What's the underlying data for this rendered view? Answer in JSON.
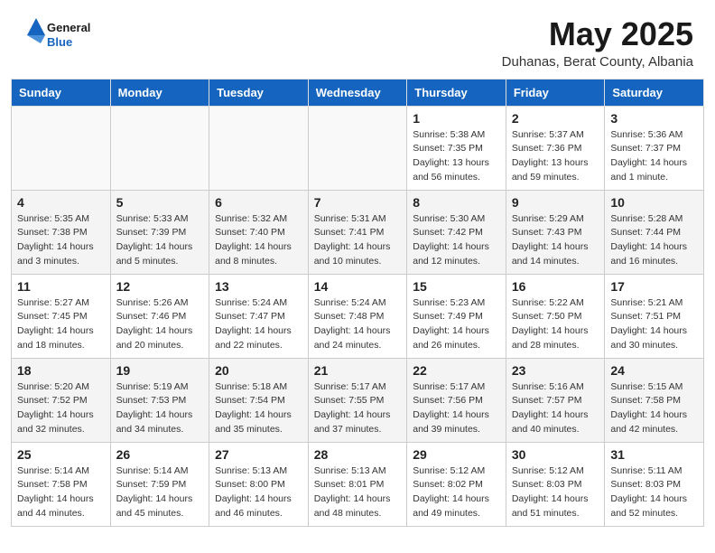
{
  "header": {
    "logo_general": "General",
    "logo_blue": "Blue",
    "month_title": "May 2025",
    "subtitle": "Duhanas, Berat County, Albania"
  },
  "weekdays": [
    "Sunday",
    "Monday",
    "Tuesday",
    "Wednesday",
    "Thursday",
    "Friday",
    "Saturday"
  ],
  "weeks": [
    [
      {
        "day": "",
        "info": ""
      },
      {
        "day": "",
        "info": ""
      },
      {
        "day": "",
        "info": ""
      },
      {
        "day": "",
        "info": ""
      },
      {
        "day": "1",
        "info": "Sunrise: 5:38 AM\nSunset: 7:35 PM\nDaylight: 13 hours\nand 56 minutes."
      },
      {
        "day": "2",
        "info": "Sunrise: 5:37 AM\nSunset: 7:36 PM\nDaylight: 13 hours\nand 59 minutes."
      },
      {
        "day": "3",
        "info": "Sunrise: 5:36 AM\nSunset: 7:37 PM\nDaylight: 14 hours\nand 1 minute."
      }
    ],
    [
      {
        "day": "4",
        "info": "Sunrise: 5:35 AM\nSunset: 7:38 PM\nDaylight: 14 hours\nand 3 minutes."
      },
      {
        "day": "5",
        "info": "Sunrise: 5:33 AM\nSunset: 7:39 PM\nDaylight: 14 hours\nand 5 minutes."
      },
      {
        "day": "6",
        "info": "Sunrise: 5:32 AM\nSunset: 7:40 PM\nDaylight: 14 hours\nand 8 minutes."
      },
      {
        "day": "7",
        "info": "Sunrise: 5:31 AM\nSunset: 7:41 PM\nDaylight: 14 hours\nand 10 minutes."
      },
      {
        "day": "8",
        "info": "Sunrise: 5:30 AM\nSunset: 7:42 PM\nDaylight: 14 hours\nand 12 minutes."
      },
      {
        "day": "9",
        "info": "Sunrise: 5:29 AM\nSunset: 7:43 PM\nDaylight: 14 hours\nand 14 minutes."
      },
      {
        "day": "10",
        "info": "Sunrise: 5:28 AM\nSunset: 7:44 PM\nDaylight: 14 hours\nand 16 minutes."
      }
    ],
    [
      {
        "day": "11",
        "info": "Sunrise: 5:27 AM\nSunset: 7:45 PM\nDaylight: 14 hours\nand 18 minutes."
      },
      {
        "day": "12",
        "info": "Sunrise: 5:26 AM\nSunset: 7:46 PM\nDaylight: 14 hours\nand 20 minutes."
      },
      {
        "day": "13",
        "info": "Sunrise: 5:24 AM\nSunset: 7:47 PM\nDaylight: 14 hours\nand 22 minutes."
      },
      {
        "day": "14",
        "info": "Sunrise: 5:24 AM\nSunset: 7:48 PM\nDaylight: 14 hours\nand 24 minutes."
      },
      {
        "day": "15",
        "info": "Sunrise: 5:23 AM\nSunset: 7:49 PM\nDaylight: 14 hours\nand 26 minutes."
      },
      {
        "day": "16",
        "info": "Sunrise: 5:22 AM\nSunset: 7:50 PM\nDaylight: 14 hours\nand 28 minutes."
      },
      {
        "day": "17",
        "info": "Sunrise: 5:21 AM\nSunset: 7:51 PM\nDaylight: 14 hours\nand 30 minutes."
      }
    ],
    [
      {
        "day": "18",
        "info": "Sunrise: 5:20 AM\nSunset: 7:52 PM\nDaylight: 14 hours\nand 32 minutes."
      },
      {
        "day": "19",
        "info": "Sunrise: 5:19 AM\nSunset: 7:53 PM\nDaylight: 14 hours\nand 34 minutes."
      },
      {
        "day": "20",
        "info": "Sunrise: 5:18 AM\nSunset: 7:54 PM\nDaylight: 14 hours\nand 35 minutes."
      },
      {
        "day": "21",
        "info": "Sunrise: 5:17 AM\nSunset: 7:55 PM\nDaylight: 14 hours\nand 37 minutes."
      },
      {
        "day": "22",
        "info": "Sunrise: 5:17 AM\nSunset: 7:56 PM\nDaylight: 14 hours\nand 39 minutes."
      },
      {
        "day": "23",
        "info": "Sunrise: 5:16 AM\nSunset: 7:57 PM\nDaylight: 14 hours\nand 40 minutes."
      },
      {
        "day": "24",
        "info": "Sunrise: 5:15 AM\nSunset: 7:58 PM\nDaylight: 14 hours\nand 42 minutes."
      }
    ],
    [
      {
        "day": "25",
        "info": "Sunrise: 5:14 AM\nSunset: 7:58 PM\nDaylight: 14 hours\nand 44 minutes."
      },
      {
        "day": "26",
        "info": "Sunrise: 5:14 AM\nSunset: 7:59 PM\nDaylight: 14 hours\nand 45 minutes."
      },
      {
        "day": "27",
        "info": "Sunrise: 5:13 AM\nSunset: 8:00 PM\nDaylight: 14 hours\nand 46 minutes."
      },
      {
        "day": "28",
        "info": "Sunrise: 5:13 AM\nSunset: 8:01 PM\nDaylight: 14 hours\nand 48 minutes."
      },
      {
        "day": "29",
        "info": "Sunrise: 5:12 AM\nSunset: 8:02 PM\nDaylight: 14 hours\nand 49 minutes."
      },
      {
        "day": "30",
        "info": "Sunrise: 5:12 AM\nSunset: 8:03 PM\nDaylight: 14 hours\nand 51 minutes."
      },
      {
        "day": "31",
        "info": "Sunrise: 5:11 AM\nSunset: 8:03 PM\nDaylight: 14 hours\nand 52 minutes."
      }
    ]
  ]
}
